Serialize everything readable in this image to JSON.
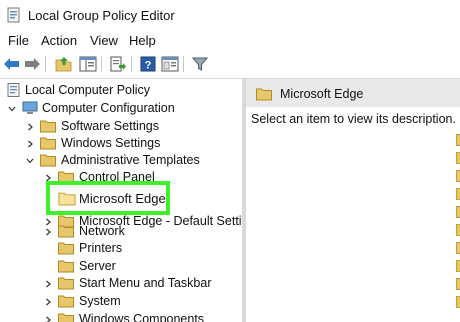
{
  "window": {
    "title": "Local Group Policy Editor"
  },
  "menu": {
    "items": [
      "File",
      "Action",
      "View",
      "Help"
    ]
  },
  "toolbar": {
    "icons": [
      "back-arrow-icon",
      "forward-arrow-icon",
      "up-folder-icon",
      "show-hide-tree-icon",
      "export-list-icon",
      "help-icon",
      "properties-icon",
      "filter-icon"
    ]
  },
  "tree": {
    "root": "Local Computer Policy",
    "computer_config": "Computer Configuration",
    "software_settings": "Software Settings",
    "windows_settings": "Windows Settings",
    "admin_templates": "Administrative Templates",
    "control_panel": "Control Panel",
    "microsoft_edge": "Microsoft Edge",
    "microsoft_edge_default": "Microsoft Edge - Default Settings",
    "network": "Network",
    "printers": "Printers",
    "server": "Server",
    "start_menu": "Start Menu and Taskbar",
    "system": "System",
    "windows_components": "Windows Components"
  },
  "details": {
    "header": "Microsoft Edge",
    "description": "Select an item to view its description."
  },
  "colors": {
    "highlight": "#3ef12a",
    "folder": "#e6c86b",
    "header_bg": "#e9e9e9"
  }
}
